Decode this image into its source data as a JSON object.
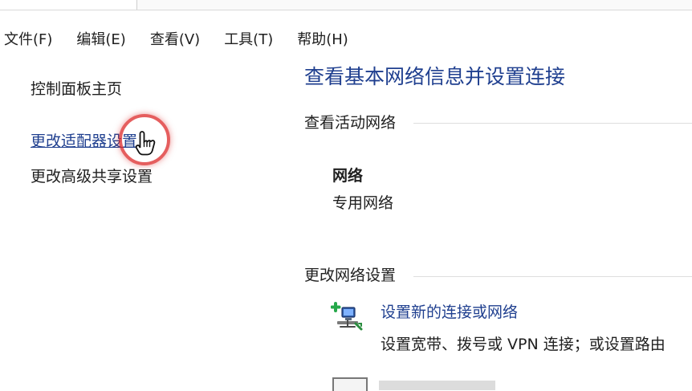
{
  "menu": {
    "file": "文件(F)",
    "edit": "编辑(E)",
    "view": "查看(V)",
    "tools": "工具(T)",
    "help": "帮助(H)"
  },
  "sidebar": {
    "home": "控制面板主页",
    "adapter": "更改适配器设置",
    "sharing": "更改高级共享设置"
  },
  "main": {
    "title": "查看基本网络信息并设置连接",
    "active_section": "查看活动网络",
    "network_name": "网络",
    "network_type": "专用网络",
    "change_section": "更改网络设置",
    "action_title": "设置新的连接或网络",
    "action_desc": "设置宽带、拨号或 VPN 连接；或设置路由"
  },
  "colors": {
    "link": "#1f3f8f",
    "text": "#202020",
    "cursor_ring": "#dc2828"
  },
  "icons": {
    "cursor": "hand-pointer-icon",
    "network_setup": "network-setup-icon"
  }
}
